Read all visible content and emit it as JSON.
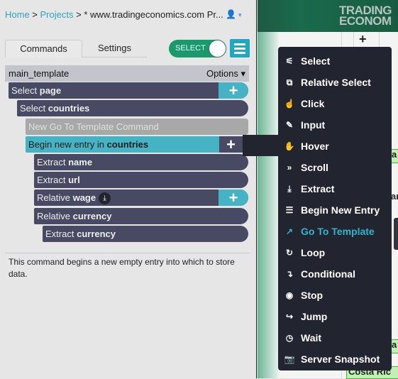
{
  "breadcrumb": {
    "home": "Home",
    "sep1": " > ",
    "projects": "Projects",
    "sep2": " > ",
    "current": "* www.tradingeconomics.com Pr..."
  },
  "user": {
    "icon": "user-icon",
    "caret": "▾"
  },
  "tabs": [
    {
      "label": "Commands",
      "active": true
    },
    {
      "label": "Settings",
      "active": false
    }
  ],
  "toggle": {
    "label": "SELECT",
    "on": true
  },
  "template": {
    "name": "main_template",
    "options": "Options ▾"
  },
  "commands": [
    {
      "verb": "Select",
      "target": "page",
      "has_plus": true
    },
    {
      "verb": "Select",
      "target": "countries"
    },
    {
      "verb": "New Go To Template Command",
      "target": ""
    },
    {
      "verb": "Begin new entry in",
      "target": "countries",
      "selected": true,
      "has_plus": true
    },
    {
      "verb": "Extract",
      "target": "name"
    },
    {
      "verb": "Extract",
      "target": "url"
    },
    {
      "verb": "Relative",
      "target": "wage",
      "has_plus": true,
      "icon": "download-icon"
    },
    {
      "verb": "Relative",
      "target": "currency"
    },
    {
      "verb": "Extract",
      "target": "currency"
    }
  ],
  "description": "This command begins a new empty entry into which to store data.",
  "page": {
    "logo": "TRADING ECONOM",
    "cells": [
      "a",
      "ar",
      "a",
      "Costa Ric"
    ]
  },
  "menu": [
    {
      "icon": "magic-wand-icon",
      "glyph": "⚟",
      "label": "Select"
    },
    {
      "icon": "relative-select-icon",
      "glyph": "⧉",
      "label": "Relative Select"
    },
    {
      "icon": "pointer-hand-icon",
      "glyph": "☝",
      "label": "Click"
    },
    {
      "icon": "pencil-icon",
      "glyph": "✎",
      "label": "Input"
    },
    {
      "icon": "hand-icon",
      "glyph": "✋",
      "label": "Hover"
    },
    {
      "icon": "double-chevron-down-icon",
      "glyph": "»",
      "label": "Scroll"
    },
    {
      "icon": "download-icon",
      "glyph": "⤓",
      "label": "Extract"
    },
    {
      "icon": "list-icon",
      "glyph": "☰",
      "label": "Begin New Entry"
    },
    {
      "icon": "external-link-icon",
      "glyph": "↗",
      "label": "Go To Template",
      "active": true
    },
    {
      "icon": "loop-icon",
      "glyph": "↻",
      "label": "Loop"
    },
    {
      "icon": "conditional-arrow-icon",
      "glyph": "↴",
      "label": "Conditional"
    },
    {
      "icon": "stop-icon",
      "glyph": "◉",
      "label": "Stop"
    },
    {
      "icon": "jump-arrow-icon",
      "glyph": "↪",
      "label": "Jump"
    },
    {
      "icon": "clock-icon",
      "glyph": "◷",
      "label": "Wait"
    },
    {
      "icon": "camera-icon",
      "glyph": "📷",
      "label": "Server Snapshot"
    }
  ],
  "colors": {
    "accent": "#45b3c4",
    "command": "#474a62",
    "toggle": "#1a9a6c",
    "menu": "#22252f",
    "active": "#2fb5cf"
  }
}
